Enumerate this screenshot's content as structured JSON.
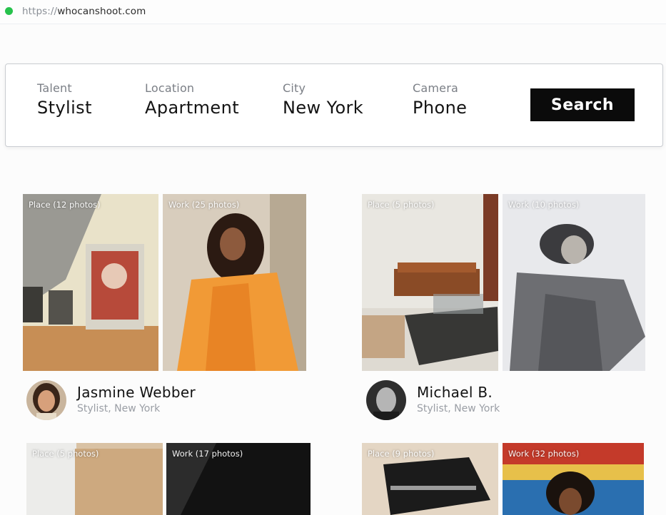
{
  "browser": {
    "url_scheme": "https://",
    "url_host": "whocanshoot.com"
  },
  "search": {
    "fields": [
      {
        "label": "Talent",
        "value": "Stylist"
      },
      {
        "label": "Location",
        "value": "Apartment"
      },
      {
        "label": "City",
        "value": "New York"
      },
      {
        "label": "Camera",
        "value": "Phone"
      }
    ],
    "button_label": "Search"
  },
  "results": [
    {
      "name": "Jasmine Webber",
      "role": "Stylist, New York",
      "place_label": "Place (12 photos)",
      "work_label": "Work (25 photos)"
    },
    {
      "name": "Michael B.",
      "role": "Stylist, New York",
      "place_label": "Place (5 photos)",
      "work_label": "Work (10 photos)"
    },
    {
      "place_label": "Place (5 photos)",
      "work_label": "Work (17 photos)"
    },
    {
      "place_label": "Place (9 photos)",
      "work_label": "Work (32 photos)"
    }
  ],
  "colors": {
    "accent": "#0b0b0b",
    "status_dot": "#27c24c",
    "muted_text": "#9a9ea5"
  }
}
